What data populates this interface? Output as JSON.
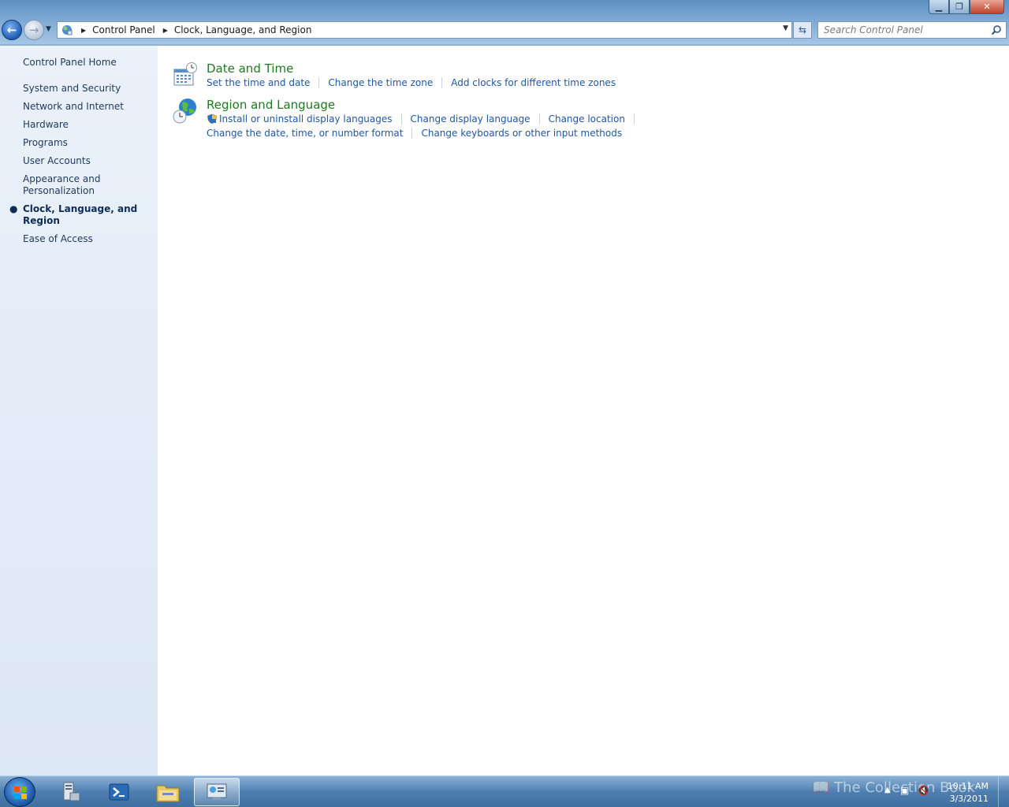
{
  "window": {
    "controls": {
      "minimize": "▁",
      "restore": "❐",
      "close": "✕"
    }
  },
  "address": {
    "crumbs": [
      "Control Panel",
      "Clock, Language, and Region"
    ]
  },
  "search": {
    "placeholder": "Search Control Panel"
  },
  "sidebar": {
    "home": "Control Panel Home",
    "items": [
      {
        "label": "System and Security"
      },
      {
        "label": "Network and Internet"
      },
      {
        "label": "Hardware"
      },
      {
        "label": "Programs"
      },
      {
        "label": "User Accounts"
      },
      {
        "label": "Appearance and Personalization"
      },
      {
        "label": "Clock, Language, and Region",
        "current": true
      },
      {
        "label": "Ease of Access"
      }
    ]
  },
  "categories": [
    {
      "title": "Date and Time",
      "links": [
        "Set the time and date",
        "Change the time zone",
        "Add clocks for different time zones"
      ]
    },
    {
      "title": "Region and Language",
      "links_row1": [
        "Install or uninstall display languages",
        "Change display language",
        "Change location"
      ],
      "links_row2": [
        "Change the date, time, or number format",
        "Change keyboards or other input methods"
      ]
    }
  ],
  "taskbar": {
    "time": "10:11 AM",
    "date": "3/3/2011",
    "watermark": "The Collection Book"
  },
  "colors": {
    "link": "#1f57a3",
    "category_title": "#1e7a1e",
    "sidebar_text": "#1e395b"
  }
}
